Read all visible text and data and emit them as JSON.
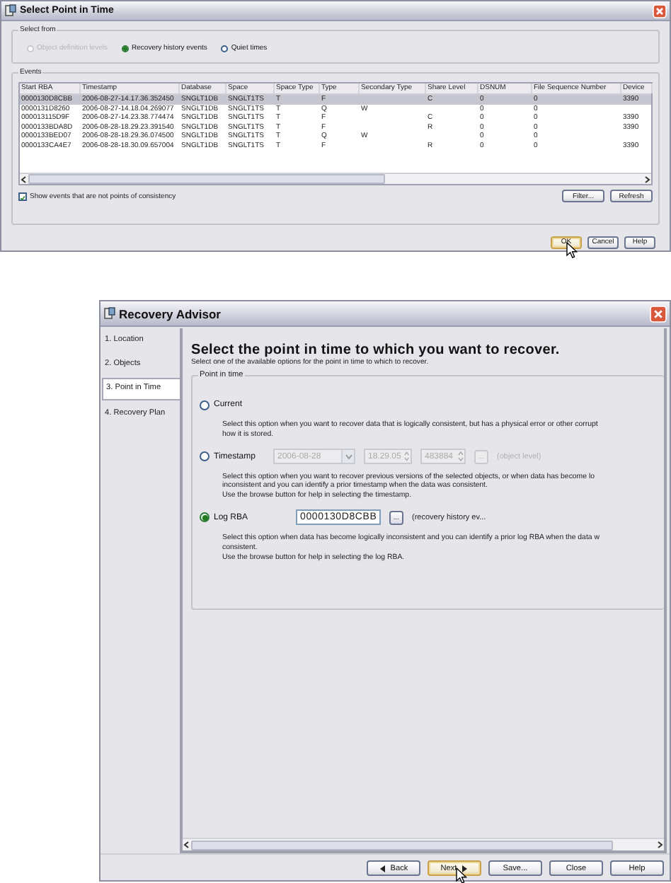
{
  "select_point_dialog": {
    "title": "Select Point in Time",
    "select_from": {
      "label": "Select from",
      "options": [
        {
          "label": "Object definition levels",
          "selected": false,
          "disabled": true
        },
        {
          "label": "Recovery history events",
          "selected": true,
          "disabled": false
        },
        {
          "label": "Quiet times",
          "selected": false,
          "disabled": false
        }
      ]
    },
    "events": {
      "label": "Events",
      "columns": [
        "Start RBA",
        "Timestamp",
        "Database",
        "Space",
        "Space Type",
        "Type",
        "Secondary Type",
        "Share Level",
        "DSNUM",
        "File Sequence Number",
        "Device"
      ],
      "rows": [
        {
          "selected": true,
          "cells": [
            "0000130D8CBB",
            "2006-08-27-14.17.36.352450",
            "SNGLT1DB",
            "SNGLT1TS",
            "T",
            "F",
            null,
            "C",
            "0",
            "0",
            "3390"
          ]
        },
        {
          "selected": false,
          "cells": [
            "0000131D8260",
            "2006-08-27-14.18.04.269077",
            "SNGLT1DB",
            "SNGLT1TS",
            "T",
            "Q",
            "W",
            null,
            "0",
            "0",
            null
          ]
        },
        {
          "selected": false,
          "cells": [
            "000013115D9F",
            "2006-08-27-14.23.38.774474",
            "SNGLT1DB",
            "SNGLT1TS",
            "T",
            "F",
            null,
            "C",
            "0",
            "0",
            "3390"
          ]
        },
        {
          "selected": false,
          "cells": [
            "0000133BDA8D",
            "2006-08-28-18.29.23.391540",
            "SNGLT1DB",
            "SNGLT1TS",
            "T",
            "F",
            null,
            "R",
            "0",
            "0",
            "3390"
          ]
        },
        {
          "selected": false,
          "cells": [
            "0000133BED07",
            "2006-08-28-18.29.36.074500",
            "SNGLT1DB",
            "SNGLT1TS",
            "T",
            "Q",
            "W",
            null,
            "0",
            "0",
            null
          ]
        },
        {
          "selected": false,
          "cells": [
            "0000133CA4E7",
            "2006-08-28-18.30.09.657004",
            "SNGLT1DB",
            "SNGLT1TS",
            "T",
            "F",
            null,
            "R",
            "0",
            "0",
            "3390"
          ]
        }
      ],
      "show_inconsistent": {
        "label": "Show events that are not points of consistency",
        "checked": true
      },
      "buttons": [
        "Filter...",
        "Refresh"
      ]
    },
    "buttons": [
      {
        "label": "OK",
        "focused": true,
        "hovered": true
      },
      {
        "label": "Cancel",
        "focused": false,
        "hovered": false
      },
      {
        "label": "Help",
        "focused": false,
        "hovered": false
      }
    ]
  },
  "recovery_advisor": {
    "title": "Recovery Advisor",
    "steps": [
      {
        "label": "1. Location",
        "selected": false
      },
      {
        "label": "2. Objects",
        "selected": false
      },
      {
        "label": "3. Point in Time",
        "selected": true
      },
      {
        "label": "4. Recovery Plan",
        "selected": false
      }
    ],
    "heading": "Select the point in time to which you want to recover.",
    "subheading": "Select one of the available options for the point in time to which to recover.",
    "group_label": "Point in time",
    "options": [
      {
        "kind": "plain",
        "label": "Current",
        "selected": false,
        "description": [
          "Select this option when you want to recover data that is logically consistent, but has a physical error or other corrupt",
          "how it is stored."
        ]
      },
      {
        "kind": "timestamp",
        "label": "Timestamp",
        "selected": false,
        "disabled": true,
        "date": "2006-08-28",
        "time": "18.29.05",
        "microseconds": "483884",
        "browse": "...",
        "note": "(object level)",
        "description": [
          "Select this option when you want to recover previous versions of the selected objects, or when data has become lo",
          "inconsistent and you can identify a prior timestamp when the data was consistent.",
          "Use the browse button for help in selecting the timestamp."
        ]
      },
      {
        "kind": "log_rba",
        "label": "Log RBA",
        "selected": true,
        "disabled": false,
        "value": "0000130D8CBB",
        "browse": "...",
        "note": "(recovery history ev...",
        "description": [
          "Select this option when data has become logically inconsistent and you can identify a prior log RBA when the data w",
          "consistent.",
          "Use the browse button for help in selecting the log RBA."
        ]
      }
    ],
    "buttons": [
      {
        "label": "Back",
        "kind": "back",
        "focused": false,
        "hovered": false
      },
      {
        "label": "Next",
        "kind": "next",
        "focused": true,
        "hovered": true
      },
      {
        "label": "Save...",
        "kind": "plain",
        "focused": false,
        "hovered": false
      },
      {
        "label": "Close",
        "kind": "plain",
        "focused": false,
        "hovered": false
      },
      {
        "label": "Help",
        "kind": "plain",
        "focused": false,
        "hovered": false
      }
    ]
  }
}
